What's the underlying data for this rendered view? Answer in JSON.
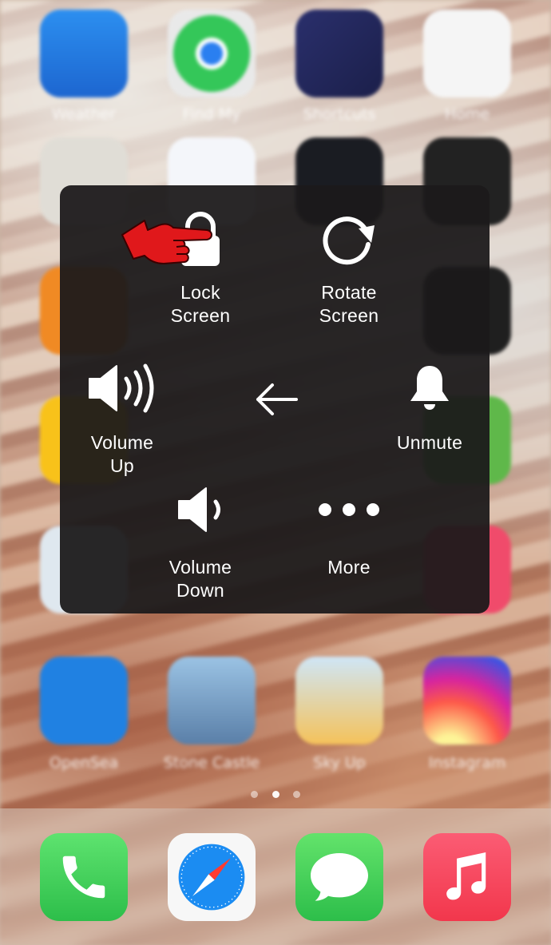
{
  "home_apps_row1": [
    "Weather",
    "Find My",
    "Shortcuts",
    "Home"
  ],
  "home_apps_row5": [
    "OpenSea",
    "Stone Castle",
    "Sky Up",
    "Instagram"
  ],
  "dock_apps": [
    "phone-icon",
    "safari-icon",
    "messages-icon",
    "music-icon"
  ],
  "menu": {
    "lock_screen": [
      "Lock",
      "Screen"
    ],
    "rotate_screen": [
      "Rotate",
      "Screen"
    ],
    "volume_up": [
      "Volume",
      "Up"
    ],
    "unmute": "Unmute",
    "volume_down": [
      "Volume",
      "Down"
    ],
    "more": "More"
  },
  "colors": {
    "menu_bg": "#1c1a1b",
    "pointer_hand": "#e0181b",
    "phone_green": "#34c759",
    "music_red": "#f2374c",
    "weather_blue": "#2f7fe0",
    "findmy_green": "#34c759",
    "home_orange": "#f6a21f",
    "instagram_pink": "#dd2a7b"
  }
}
